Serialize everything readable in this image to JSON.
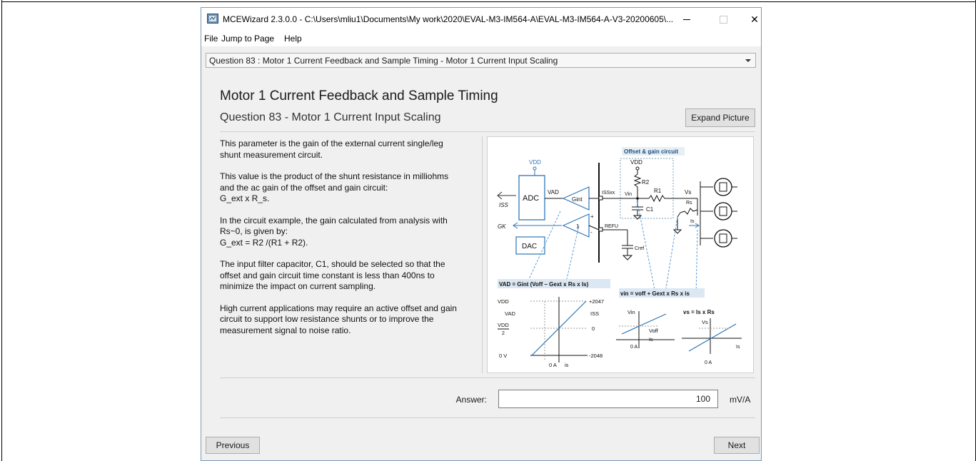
{
  "window": {
    "title": "MCEWizard 2.3.0.0 - C:\\Users\\mliu1\\Documents\\My work\\2020\\EVAL-M3-IM564-A\\EVAL-M3-IM564-A-V3-20200605\\...",
    "controls": {
      "minimize": "–",
      "maximize": "□",
      "close": "✕"
    }
  },
  "menu": {
    "items": [
      {
        "label": "File"
      },
      {
        "label": "Jump to Page"
      },
      {
        "label": "Help"
      }
    ]
  },
  "question_select": {
    "value": "Question  83 : Motor 1 Current Feedback and Sample Timing - Motor 1 Current Input Scaling"
  },
  "page": {
    "section_title": "Motor 1 Current Feedback and Sample Timing",
    "question_title": "Question 83 - Motor 1 Current Input Scaling",
    "expand_label": "Expand Picture"
  },
  "description": [
    "This parameter is the gain of the external current single/leg\nshunt measurement circuit.",
    "This value is the product of the shunt resistance in milliohms\nand the ac gain of the offset and gain circuit:\n        G_ext x R_s.",
    "In the circuit example, the gain calculated from analysis with\nRs~0, is given by:\n        G_ext = R2 /(R1 + R2).",
    "The input filter capacitor, C1, should be selected so that the\noffset and gain circuit time constant is less than 400ns to\nminimize the impact on current sampling.",
    "High current applications may require an active offset and gain\ncircuit to support low resistance shunts or to improve the\nmeasurement signal to noise ratio."
  ],
  "diagram": {
    "labels": {
      "offset_gain_title": "Offset & gain circuit",
      "vdd_adc": "VDD",
      "vdd_r2": "VDD",
      "adc": "ADC",
      "dac": "DAC",
      "iss": "ISS",
      "gk": "GK",
      "vad": "VAD",
      "gint": "Gint",
      "amp1": "1",
      "plus": "+",
      "minus": "-",
      "issxx": "ISSxx",
      "vin": "Vin",
      "r2": "R2",
      "r1": "R1",
      "c1": "C1",
      "vs": "Vs",
      "rs": "Rs",
      "is": "Is",
      "refu": "REFU",
      "cref": "Cref"
    },
    "formulas": {
      "vad_eq": "VAD = Gint (Voff – Gext x Rs x Is)",
      "vin_eq": "vin = voff + Gext x Rs x is",
      "vs_eq": "vs = Is x Rs"
    },
    "graph1": {
      "vdd": "VDD",
      "vad": "VAD",
      "vdd2": "VDD",
      "vdd2_den": "2",
      "ov": "0 V",
      "p2047": "+2047",
      "iss": "ISS",
      "zero": "0",
      "m2048": "-2048",
      "oa": "0 A",
      "is": "is"
    },
    "graph2": {
      "vin": "Vin",
      "voff": "Voff",
      "oa": "0 A",
      "is": "Is"
    },
    "graph3": {
      "vs": "Vs",
      "oa": "0 A",
      "is": "Is"
    }
  },
  "answer": {
    "label": "Answer:",
    "value": "100",
    "unit": "mV/A"
  },
  "navigation": {
    "previous": "Previous",
    "next": "Next"
  },
  "colors": {
    "accent_blue": "#3a7fc0",
    "picture_bg": "#ffffff"
  }
}
